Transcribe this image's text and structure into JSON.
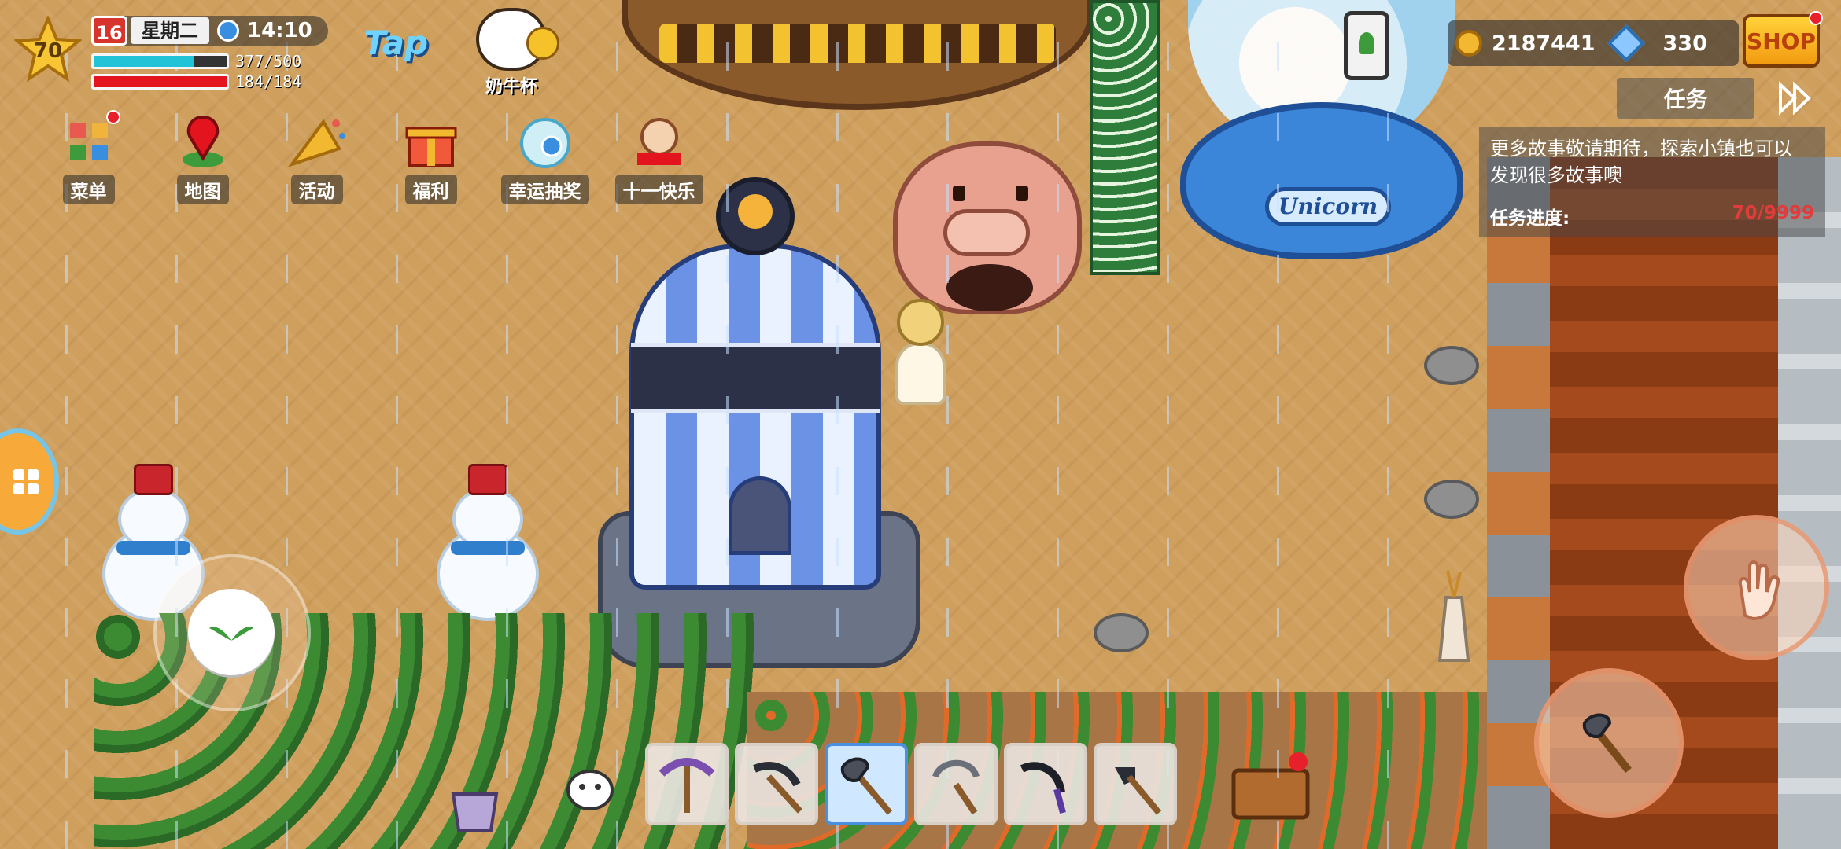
{
  "player": {
    "level": "70",
    "energy_text": "377/500",
    "energy_fraction": 0.754,
    "health_text": "184/184",
    "health_fraction": 1.0
  },
  "date": {
    "day_number": "16",
    "weekday": "星期二",
    "time": "14:10"
  },
  "top_logo": "Tap",
  "cow_cup": {
    "label": "奶牛杯"
  },
  "menu": [
    {
      "id": "menu",
      "label": "菜单",
      "icon": "grid-menu-icon",
      "badge": true
    },
    {
      "id": "map",
      "label": "地图",
      "icon": "map-pin-icon",
      "badge": false
    },
    {
      "id": "events",
      "label": "活动",
      "icon": "party-horn-icon",
      "badge": false
    },
    {
      "id": "welfare",
      "label": "福利",
      "icon": "gift-icon",
      "badge": false
    },
    {
      "id": "lucky",
      "label": "幸运抽奖",
      "icon": "lucky-draw-icon",
      "badge": false
    },
    {
      "id": "national-day",
      "label": "十一快乐",
      "icon": "national-day-icon",
      "badge": false
    }
  ],
  "currency": {
    "coins": "2187441",
    "gems": "330"
  },
  "shop_label": "SHOP",
  "task": {
    "title": "任务",
    "description": "更多故事敬请期待，探索小镇也可以发现很多故事噢",
    "progress_label": "任务进度:",
    "progress_value": "70/9999"
  },
  "scene": {
    "globe_plate": "Unicorn"
  },
  "hotbar": {
    "active_index": 2,
    "slots": [
      {
        "icon": "pickaxe-purple-icon"
      },
      {
        "icon": "pickaxe-dark-icon"
      },
      {
        "icon": "axe-icon"
      },
      {
        "icon": "sickle-icon"
      },
      {
        "icon": "scythe-icon"
      },
      {
        "icon": "hoe-icon"
      }
    ]
  },
  "colors": {
    "energy": "#22c3d6",
    "health": "#e3141e",
    "badge": "#e8202c",
    "task_progress": "#e23b3b",
    "shop_bg": "#f8b41e"
  }
}
